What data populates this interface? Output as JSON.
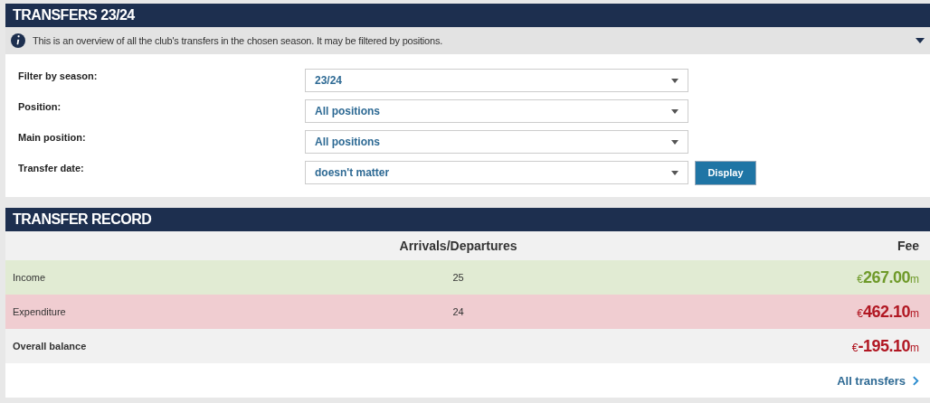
{
  "transfers_box": {
    "title": "TRANSFERS 23/24",
    "info": "This is an overview of all the club's transfers in the chosen season. It may be filtered by positions.",
    "filters": [
      {
        "label": "Filter by season:",
        "value": "23/24"
      },
      {
        "label": "Position:",
        "value": "All positions"
      },
      {
        "label": "Main position:",
        "value": "All positions"
      },
      {
        "label": "Transfer date:",
        "value": "doesn't matter"
      }
    ],
    "button": "Display"
  },
  "record_box": {
    "title": "TRANSFER RECORD",
    "columns": [
      "Arrivals/Departures",
      "Fee"
    ],
    "rows": [
      {
        "kind": "income",
        "label": "Income",
        "count": "25",
        "fee": "€**267.00**m"
      },
      {
        "kind": "expenditure",
        "label": "Expenditure",
        "count": "24",
        "fee": "€**462.10**m"
      },
      {
        "kind": "balance",
        "label": "Overall balance",
        "fee": "€**-195.10**m"
      }
    ],
    "link": "All transfers"
  }
}
